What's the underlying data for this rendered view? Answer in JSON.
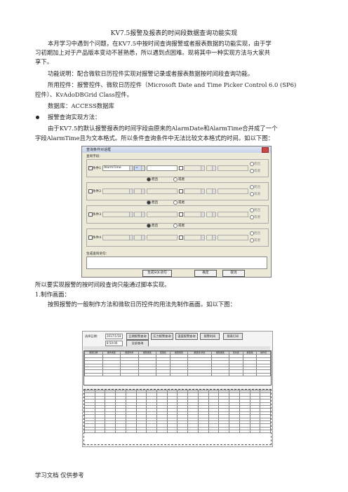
{
  "title": "KV7.5报警及报表的时间段数据查询功能实现",
  "paragraphs": [
    "本月学习中遇到个问题，在KV7.5中按时间查询报警或者报表数据的功能实现，由于学",
    "习初期加上对于产品版本变动不甚熟悉，所以遇到点困难。现将其中一种实现方法与大家共",
    "享下。",
    "功能说明：配合微软日历控件实现对报警记录或者报表数据按时间段查询功能。",
    "所用控件：报警控件、微软日历控件（Microsoft Date and Time Picker Control 6.0 (SP6)",
    "控件）、KvAdoDBGrid Class控件。",
    "数据库：ACCESS数据库",
    "报警查询实现方法：",
    "由于KV7.5的默认报警报表的时间字段由原来的AlarmDate和AlarmTime合并成了一个",
    "字段AlarmTime且为文本格式。所以条件查询条件中无法比较文本格式的时间。如以下图：",
    "所以要实现报警的按时间段查询只能通过脚本实现。",
    "1.制作画面：",
    "按照报警的一般制作方法和微软日历控件的用法先制作画面。如以下图："
  ],
  "footer": "学习文档 仅供参考",
  "dialog": {
    "title": "查询条件对话框",
    "field_label": "查询字段:",
    "cond1": "条件1",
    "cond2": "条件2",
    "cond3": "条件3",
    "cond4": "条件4",
    "field_value": "AlarmTime",
    "op_value": "=",
    "and_label": "而且",
    "or_label": "或者",
    "sql_label": "生成查询语句:",
    "gen_btn": "生成SQL语句",
    "ok_btn": "确定",
    "cancel_btn": "取消"
  },
  "form": {
    "label": "选择日期:",
    "date1": "2017/1/18",
    "time1": "8:50:00",
    "btn_day": "日期报警查询",
    "btn_pressure": "压力报警查询",
    "btn_temp": "温度报警查询",
    "btn_time": "报警时间",
    "btn_report": "报表打印",
    "btn_all": "全部查询",
    "headers": [
      "报警日期",
      "事件类型",
      "报警时间",
      "报警类型",
      "变量名",
      "报警限值",
      "报警值/状态",
      "报警类型",
      "优先级",
      "报警组",
      "操作员"
    ]
  }
}
